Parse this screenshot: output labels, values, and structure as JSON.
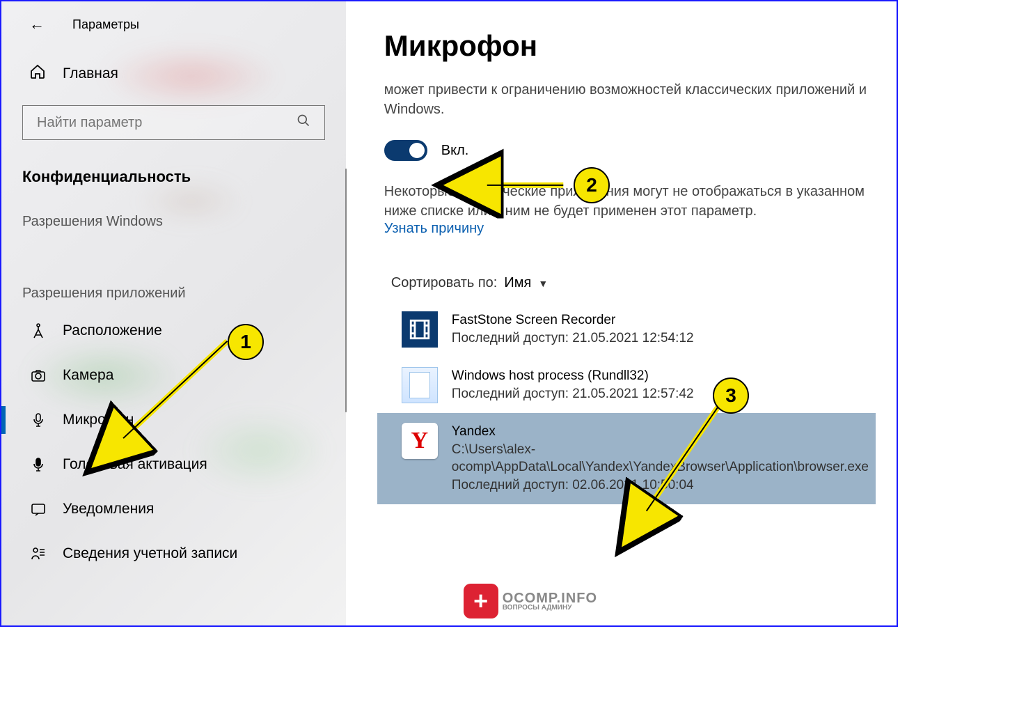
{
  "window": {
    "title": "Параметры"
  },
  "sidebar": {
    "home": "Главная",
    "search_placeholder": "Найти параметр",
    "category": "Конфиденциальность",
    "group_windows": "Разрешения Windows",
    "group_apps": "Разрешения приложений",
    "items": {
      "location": "Расположение",
      "camera": "Камера",
      "microphone": "Микрофон",
      "voice": "Голосовая активация",
      "notifications": "Уведомления",
      "account": "Сведения учетной записи"
    }
  },
  "main": {
    "heading": "Микрофон",
    "para1": "может привести к ограничению возможностей классических приложений и Windows.",
    "toggle_label": "Вкл.",
    "para2": "Некоторые классические приложения могут не отображаться в указанном ниже списке или к ним не будет применен этот параметр.",
    "link": "Узнать причину",
    "sort_label": "Сортировать по:",
    "sort_value": "Имя",
    "apps": [
      {
        "name": "FastStone Screen Recorder",
        "meta": "Последний доступ: 21.05.2021 12:54:12"
      },
      {
        "name": "Windows host process (Rundll32)",
        "meta": "Последний доступ: 21.05.2021 12:57:42"
      },
      {
        "name": "Yandex",
        "path": "C:\\Users\\alex-ocomp\\AppData\\Local\\Yandex\\YandexBrowser\\Application\\browser.exe",
        "meta": "Последний доступ: 02.06.2021 10:50:04"
      }
    ]
  },
  "annotations": {
    "one": "1",
    "two": "2",
    "three": "3"
  },
  "watermark": {
    "brand": "OCOMP.INFO",
    "sub": "ВОПРОСЫ АДМИНУ"
  }
}
